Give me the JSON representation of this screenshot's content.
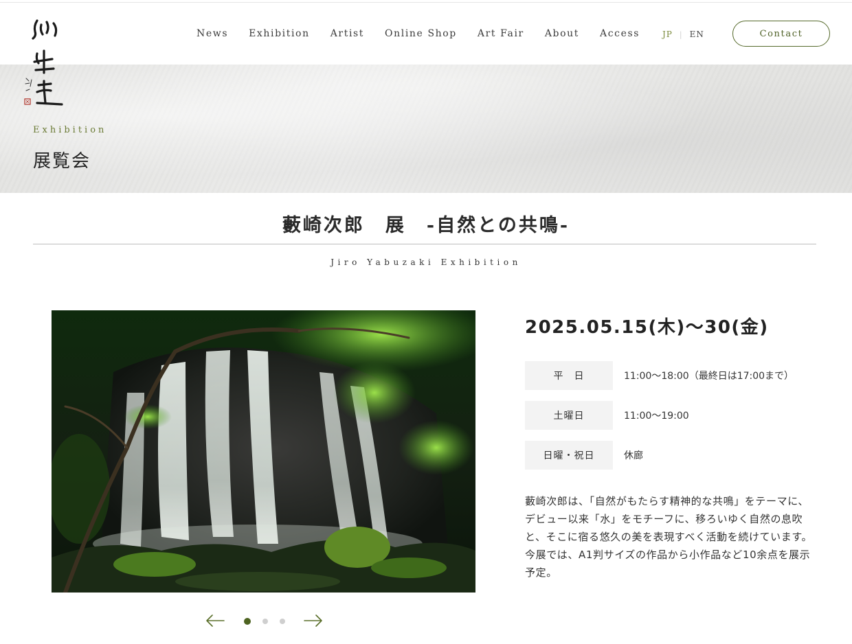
{
  "header": {
    "logo_text": "彩生堂",
    "nav": [
      "News",
      "Exhibition",
      "Artist",
      "Online Shop",
      "Art Fair",
      "About",
      "Access"
    ],
    "lang_jp": "JP",
    "lang_sep": "|",
    "lang_en": "EN",
    "contact_label": "Contact",
    "accent_color": "#55692a"
  },
  "hero": {
    "en_label": "Exhibition",
    "jp_label": "展覧会"
  },
  "exhibition": {
    "title": "藪崎次郎　展　-自然との共鳴-",
    "subtitle": "Jiro Yabuzaki Exhibition",
    "dates": "2025.05.15(木)～30(金)",
    "hours": [
      {
        "label": "平　日",
        "value": "11:00〜18:00（最終日は17:00まで）"
      },
      {
        "label": "土曜日",
        "value": "11:00〜19:00"
      },
      {
        "label": "日曜・祝日",
        "value": "休廊"
      }
    ],
    "description": [
      "藪崎次郎は、「自然がもたらす精神的な共鳴」をテーマに、デビュー以来「水」をモチーフに、移ろいゆく自然の息吹と、そこに宿る悠久の美を表現すべく活動を続けています。",
      "今展では、A1判サイズの作品から小作品など10余点を展示予定。"
    ]
  },
  "slider": {
    "prev_icon": "arrow-left-icon",
    "next_icon": "arrow-right-icon",
    "slide_count": 3,
    "active_index": 0
  },
  "image": {
    "subject": "waterfall-photo"
  }
}
